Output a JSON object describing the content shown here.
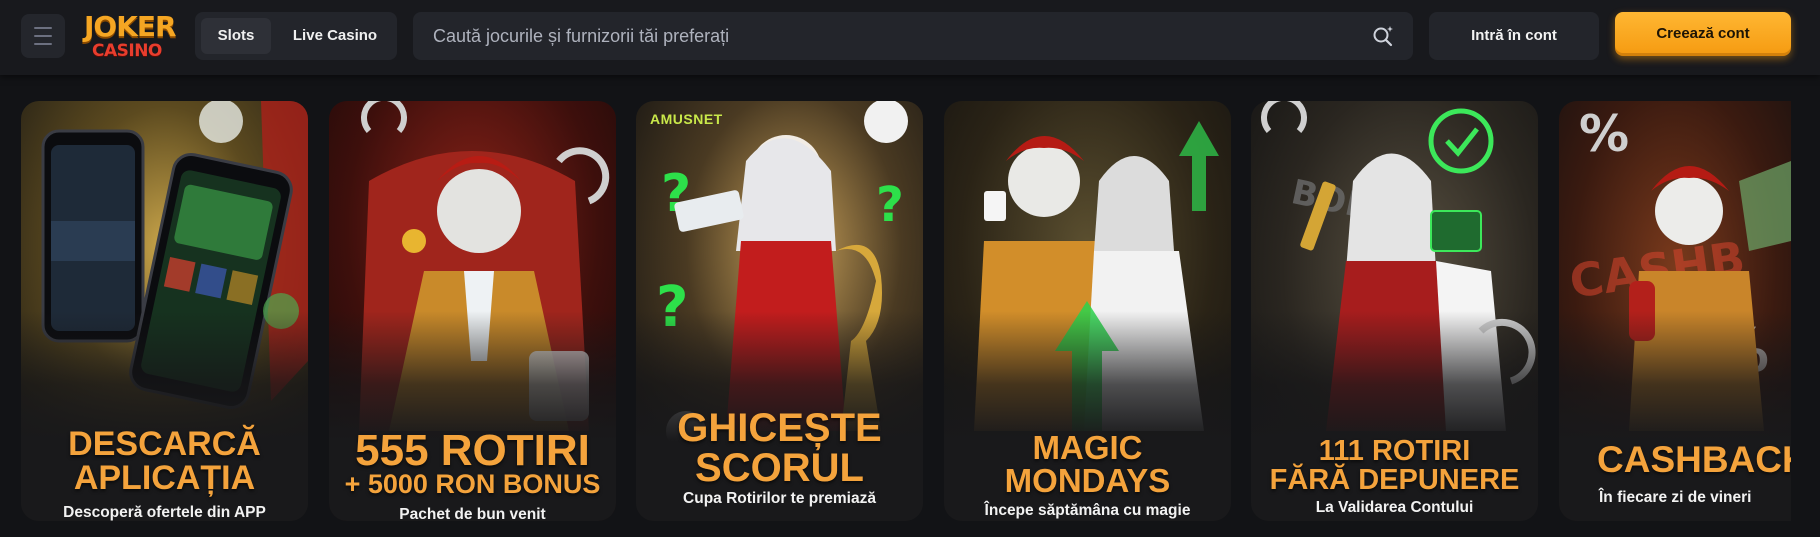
{
  "header": {
    "logo_line1": "JOKER",
    "logo_line2": "CASINO",
    "tabs": [
      {
        "label": "Slots"
      },
      {
        "label": "Live Casino"
      }
    ],
    "search_placeholder": "Caută jocurile și furnizorii tăi preferați",
    "login_label": "Intră în cont",
    "register_label": "Creează cont"
  },
  "promos": [
    {
      "title": "DESCARCĂ APLICAȚIA",
      "title_lines": [
        "DESCARCĂ",
        "APLICAȚIA"
      ],
      "subtitle": "Descoperă ofertele din APP"
    },
    {
      "title_lines": [
        "555 ROTIRI",
        "+ 5000 RON BONUS"
      ],
      "subtitle": "Pachet de bun venit"
    },
    {
      "title_lines": [
        "GHICEȘTE",
        "SCORUL"
      ],
      "subtitle": "Cupa Rotirilor te premiază",
      "provider": "AMUSNET"
    },
    {
      "title_lines": [
        "MAGIC",
        "MONDAYS"
      ],
      "subtitle": "Începe săptămâna cu magie"
    },
    {
      "title_lines": [
        "111 ROTIRI",
        "FĂRĂ DEPUNERE"
      ],
      "subtitle": "La Validarea Contului"
    },
    {
      "title_lines": [
        "CASHBACK"
      ],
      "subtitle": "În fiecare zi de vineri"
    }
  ],
  "icons": {
    "menu": "hamburger-icon",
    "search": "search-sparkle-icon"
  },
  "colors": {
    "accent": "#f5a623",
    "promo_title": "#f4a33c",
    "background": "#121316"
  }
}
